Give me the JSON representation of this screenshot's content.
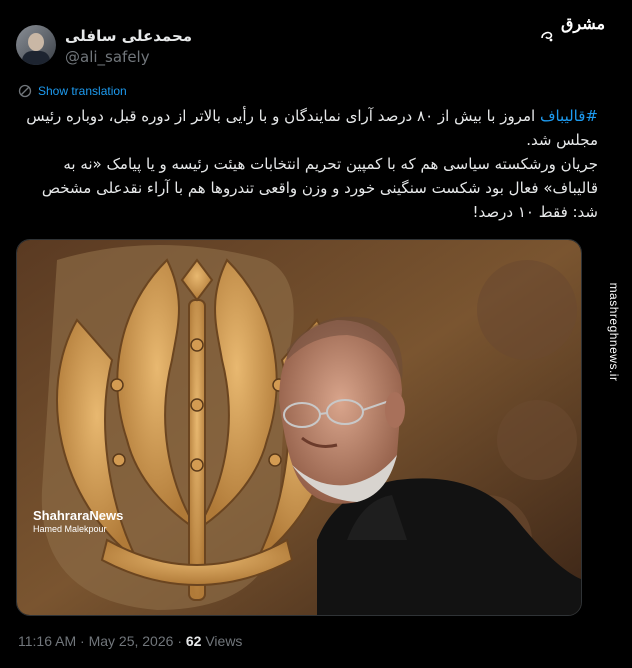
{
  "author": {
    "display_name": "محمدعلی سافلی",
    "handle": "@ali_safely"
  },
  "brand": {
    "logo_text": "مشرق",
    "side_url": "mashreghnews.ir"
  },
  "translate_label": "Show translation",
  "tweet": {
    "hashtag": "#قالیباف",
    "line1_rest": " امروز با بیش از ۸۰ درصد آرای نمایندگان و با رأیی بالاتر از دوره قبل، دوباره رئیس مجلس شد.",
    "line2": "جریان ورشکسته سیاسی هم که با کمپین تحریم انتخابات هیئت رئیسه و یا پیامک «نه به قالیباف» فعال بود شکست سنگینی خورد و وزن واقعی تندروها هم با آراء نقدعلی مشخص شد: فقط ۱۰ درصد!"
  },
  "media": {
    "watermark_name": "ShahraraNews",
    "watermark_credit": "Hamed Malekpour",
    "alt_icon": "photo"
  },
  "meta": {
    "time": "11:16 AM",
    "separator": "·",
    "date": "May 25, 2026",
    "views_count": "62",
    "views_label": "Views"
  },
  "colors": {
    "background": "#000000",
    "link": "#1d9bf0",
    "muted": "#71767b",
    "text": "#e7e9ea"
  },
  "icons": [
    "translate-globe-icon",
    "brand-swirl-icon",
    "avatar-image"
  ]
}
